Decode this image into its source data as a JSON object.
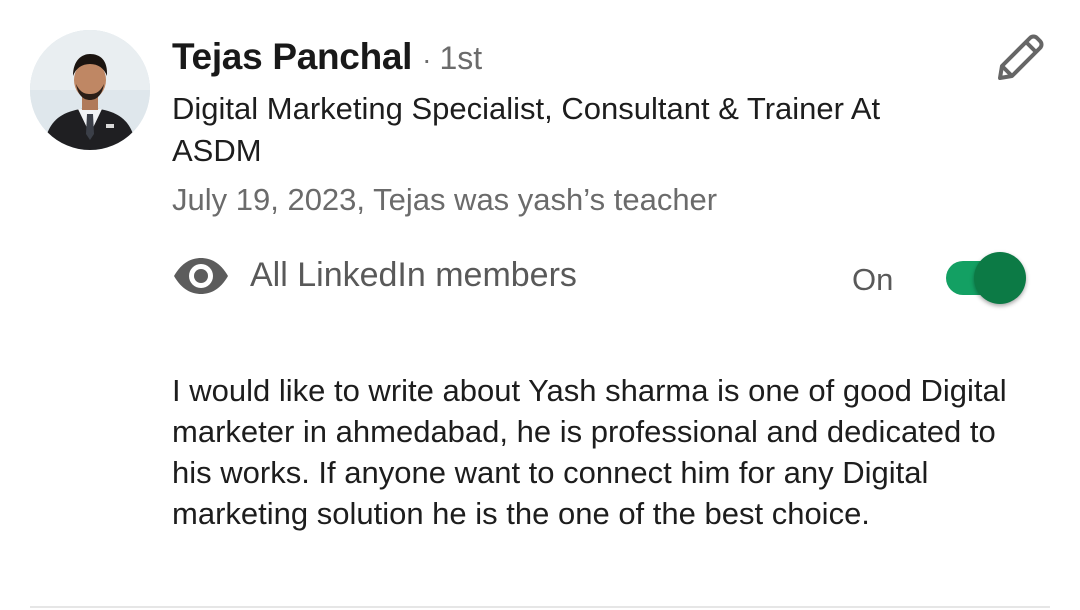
{
  "recommender": {
    "name": "Tejas Panchal",
    "separator": "·",
    "degree": "1st",
    "headline": "Digital Marketing Specialist, Consultant & Trainer At ASDM",
    "meta": "July 19, 2023, Tejas was yash’s teacher"
  },
  "visibility": {
    "icon": "eye-icon",
    "label": "All LinkedIn members",
    "toggle_state_label": "On",
    "toggle_on": true
  },
  "recommendation_text": "I would like to write about Yash sharma is one of good Digital marketer in ahmedabad, he is professional and dedicated to his works. If anyone want to connect him for any Digital marketing solution he is the one of the best choice.",
  "icons": {
    "edit": "pencil-icon"
  },
  "colors": {
    "toggle_track": "#13a063",
    "toggle_knob": "#0c7a45",
    "secondary_text": "#6b6b6b"
  }
}
